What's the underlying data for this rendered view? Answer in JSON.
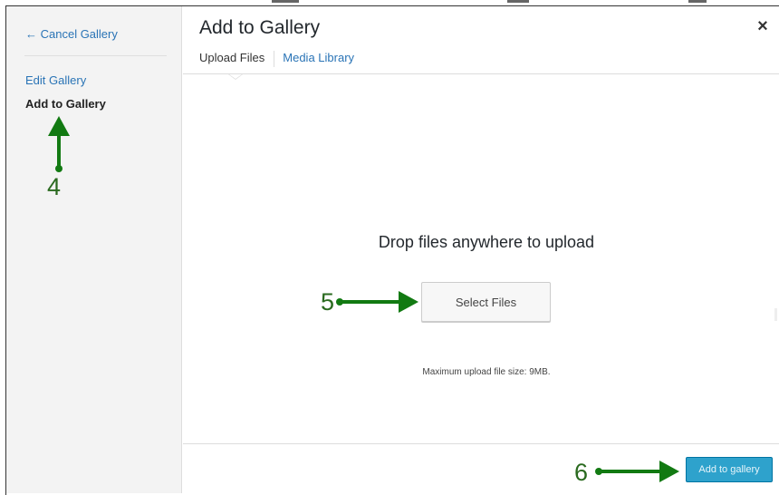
{
  "sidebar": {
    "cancel_link": "← Cancel Gallery",
    "items": [
      {
        "label": "Edit Gallery"
      },
      {
        "label": "Add to Gallery"
      }
    ]
  },
  "modal": {
    "title": "Add to Gallery",
    "close_label": "×",
    "tabs": [
      {
        "label": "Upload Files",
        "active": true
      },
      {
        "label": "Media Library",
        "active": false
      }
    ]
  },
  "uploader": {
    "drop_text": "Drop files anywhere to upload",
    "select_button": "Select Files",
    "max_size_text": "Maximum upload file size: 9MB."
  },
  "footer": {
    "add_button": "Add to gallery"
  },
  "annotations": {
    "step4": "4",
    "step5": "5",
    "step6": "6",
    "arrow_color": "#127a12"
  },
  "colors": {
    "link": "#2a74b6",
    "primary_button": "#2ea2cc"
  }
}
